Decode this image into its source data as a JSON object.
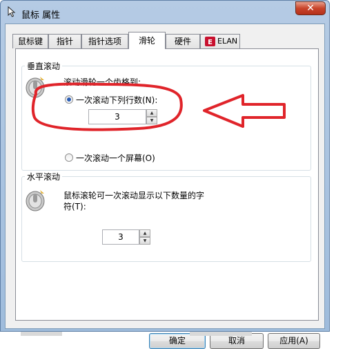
{
  "window": {
    "title": "鼠标 属性",
    "close_label": "✕"
  },
  "tabs": [
    {
      "label": "鼠标键"
    },
    {
      "label": "指针"
    },
    {
      "label": "指针选项"
    },
    {
      "label": "滑轮",
      "active": true
    },
    {
      "label": "硬件"
    },
    {
      "label": "ELAN"
    }
  ],
  "vertical_scroll": {
    "title": "垂直滚动",
    "prompt": "滚动滑轮一个齿格到:",
    "option_lines_label": "一次滚动下列行数(N):",
    "lines_value": "3",
    "option_screen_label": "一次滚动一个屏幕(O)"
  },
  "horizontal_scroll": {
    "title": "水平滚动",
    "prompt_line1": "鼠标滚轮可一次滚动显示以下数量的字",
    "prompt_line2": "符(T):",
    "chars_value": "3"
  },
  "buttons": {
    "ok": "确定",
    "cancel": "取消",
    "apply": "应用(A)"
  },
  "colors": {
    "annotation_red": "#e0242a",
    "selection_blue": "#2a5db5"
  }
}
